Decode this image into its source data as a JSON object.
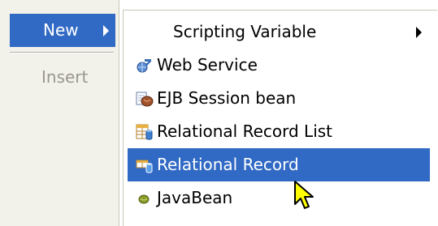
{
  "left_menu": {
    "new_label": "New",
    "insert_label": "Insert"
  },
  "submenu": {
    "items": [
      {
        "label": "Scripting Variable",
        "icon": "none",
        "has_submenu": true
      },
      {
        "label": "Web Service",
        "icon": "web-service-icon"
      },
      {
        "label": "EJB Session bean",
        "icon": "ejb-bean-icon"
      },
      {
        "label": "Relational Record List",
        "icon": "relational-record-list-icon"
      },
      {
        "label": "Relational Record",
        "icon": "relational-record-icon",
        "highlighted": true
      },
      {
        "label": "JavaBean",
        "icon": "javabean-icon"
      }
    ]
  },
  "colors": {
    "highlight": "#316ac5",
    "menu_background": "#f2f1ea",
    "disabled_text": "#9a988d"
  }
}
